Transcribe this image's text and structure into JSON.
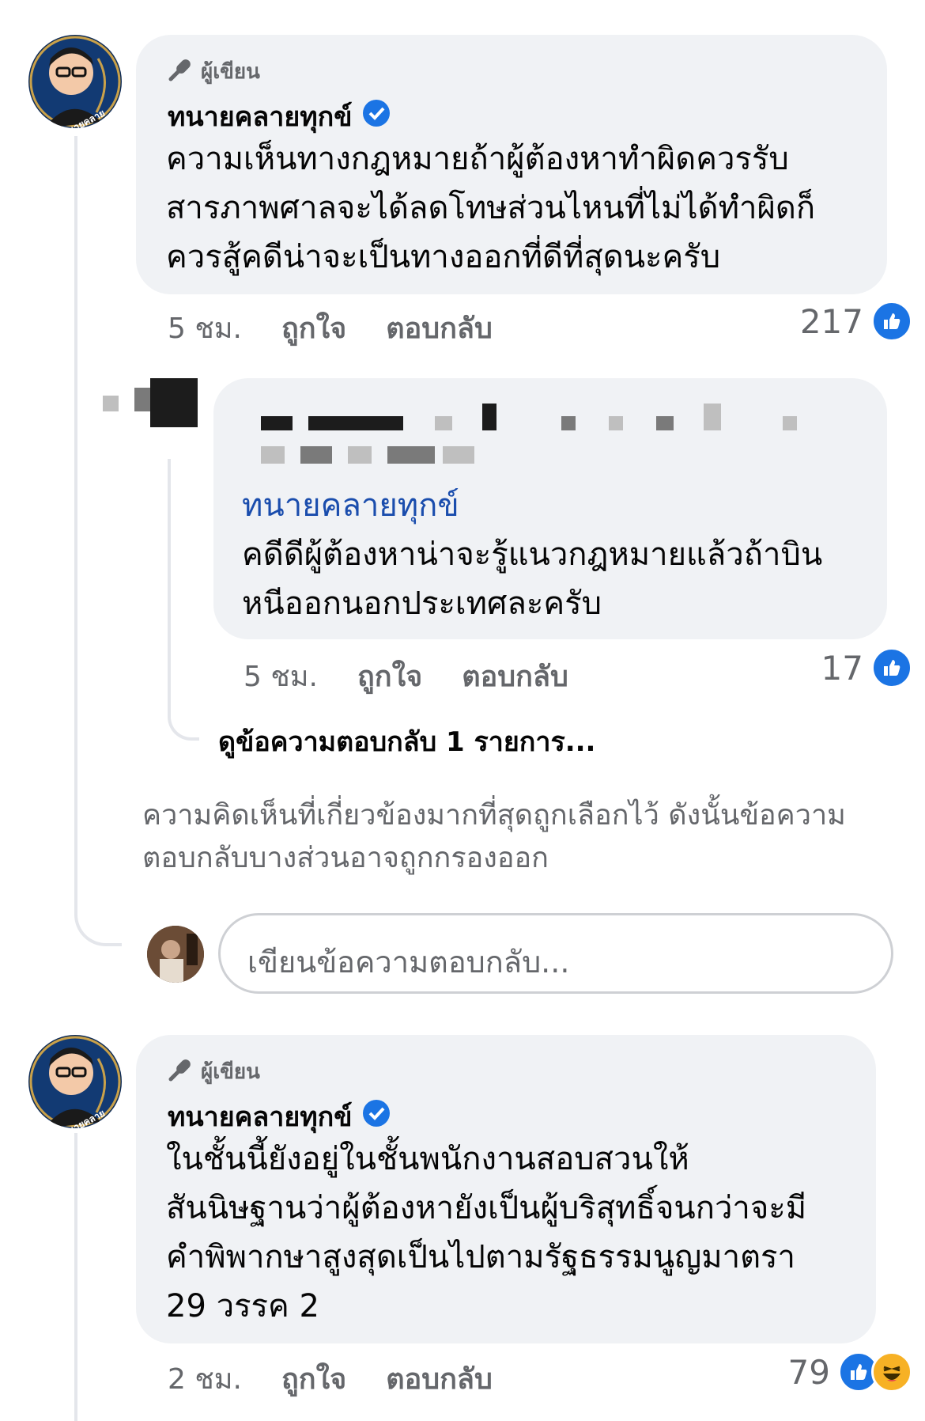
{
  "colors": {
    "like": "#1b74e4",
    "bubble": "#f0f2f5",
    "meta": "#65676b",
    "mention": "#1a4dad",
    "verified": "#1b74e4"
  },
  "comment1": {
    "author_badge": "ผู้เขียน",
    "author_name": "ทนายคลายทุกข์",
    "avatar_caption": "ทนายคลายทุกข์",
    "lines": [
      "ความเห็นทางกฎหมายถ้าผู้ต้องหาทำผิดควรรับ",
      "สารภาพศาลจะได้ลดโทษส่วนไหนที่ไม่ได้ทำผิดก็",
      "ควรสู้คดีน่าจะเป็นทางออกที่ดีที่สุดนะครับ"
    ],
    "time": "5 ชม.",
    "like_action": "ถูกใจ",
    "reply_action": "ตอบกลับ",
    "reaction_count": "217",
    "reaction_icons": [
      "like-icon"
    ]
  },
  "reply1": {
    "mention": "ทนายคลายทุกข์",
    "lines": [
      "คดีดีผู้ต้องหาน่าจะรู้แนวกฎหมายแล้วถ้าบิน",
      "หนีออกนอกประเทศละครับ"
    ],
    "time": "5 ชม.",
    "like_action": "ถูกใจ",
    "reply_action": "ตอบกลับ",
    "reaction_count": "17",
    "reaction_icons": [
      "like-icon"
    ]
  },
  "view_replies": "ดูข้อความตอบกลับ 1 รายการ...",
  "filter_notice": [
    "ความคิดเห็นที่เกี่ยวข้องมากที่สุดถูกเลือกไว้ ดังนั้นข้อความ",
    "ตอบกลับบางส่วนอาจถูกกรองออก"
  ],
  "reply_input": {
    "placeholder": "เขียนข้อความตอบกลับ..."
  },
  "comment2": {
    "author_badge": "ผู้เขียน",
    "author_name": "ทนายคลายทุกข์",
    "avatar_caption": "ทนายคลายทุกข์",
    "lines": [
      "ในชั้นนี้ยังอยู่ในชั้นพนักงานสอบสวนให้",
      "สันนิษฐานว่าผู้ต้องหายังเป็นผู้บริสุทธิ์จนกว่าจะมี",
      "คำพิพากษาสูงสุดเป็นไปตามรัฐธรรมนูญมาตรา",
      "29 วรรค 2"
    ],
    "time": "2 ชม.",
    "like_action": "ถูกใจ",
    "reply_action": "ตอบกลับ",
    "reaction_count": "79",
    "reaction_icons": [
      "like-icon",
      "haha-icon"
    ]
  }
}
